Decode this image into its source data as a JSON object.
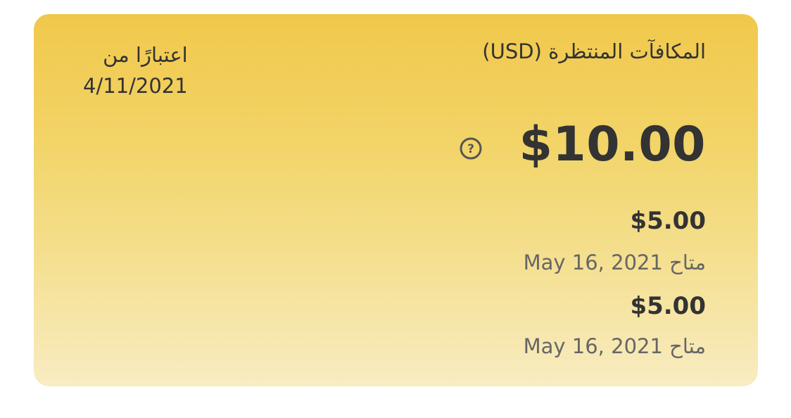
{
  "card": {
    "title": "المكافآت المنتظرة (USD)",
    "as_of_label": "اعتبارًا من",
    "as_of_date": "4/11/2021",
    "total": "$10.00",
    "help_icon": "question-circle-icon",
    "payouts": [
      {
        "amount": "$5.00",
        "available": "متاح May 16, 2021"
      },
      {
        "amount": "$5.00",
        "available": "متاح May 16, 2021"
      }
    ]
  },
  "colors": {
    "card_top": "#f1c84b",
    "card_bottom": "#f8ecc2",
    "text_primary": "#333333",
    "text_secondary": "#666666"
  }
}
